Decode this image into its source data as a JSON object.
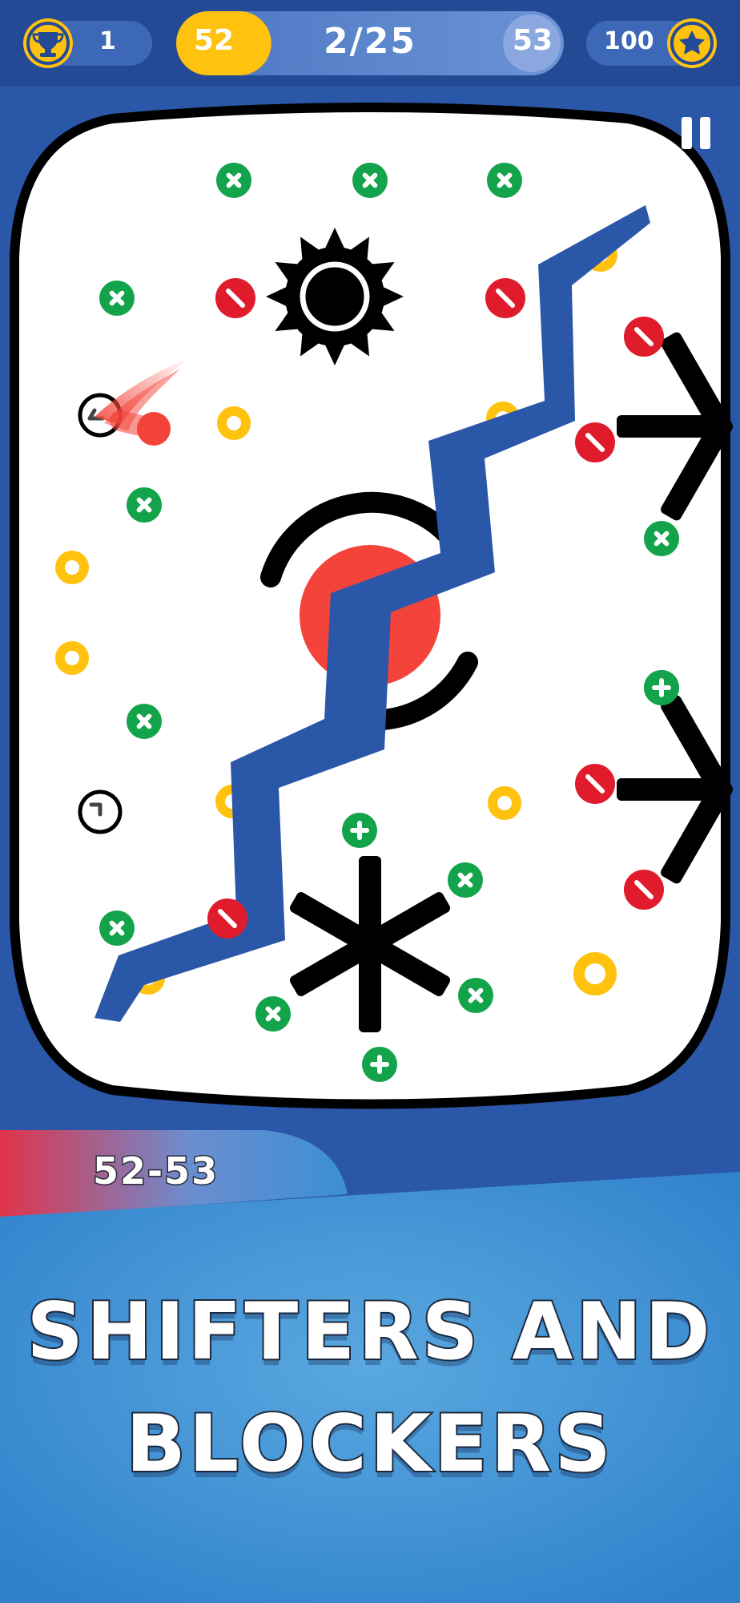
{
  "hud": {
    "trophy_count": "1",
    "current_level": "52",
    "progress": "2/25",
    "next_level": "53",
    "stars": "100",
    "progress_fraction": 0.08
  },
  "level_tag": "52-53",
  "banner": {
    "line1": "SHIFTERS AND",
    "line2": "BLOCKERS"
  },
  "colors": {
    "background": "#2b57a8",
    "board": "#ffffff",
    "gold": "#ffc20e",
    "green": "#12a34b",
    "red": "#e01b2b",
    "ball": "#f4433a",
    "bottom_panel": "#3b8fd4"
  },
  "icons": [
    "trophy-icon",
    "star-icon",
    "pause-icon",
    "plus-peg-icon",
    "minus-peg-icon",
    "ring-peg-icon",
    "spinner-icon",
    "gear-blocker-icon",
    "asterisk-blocker-icon"
  ]
}
